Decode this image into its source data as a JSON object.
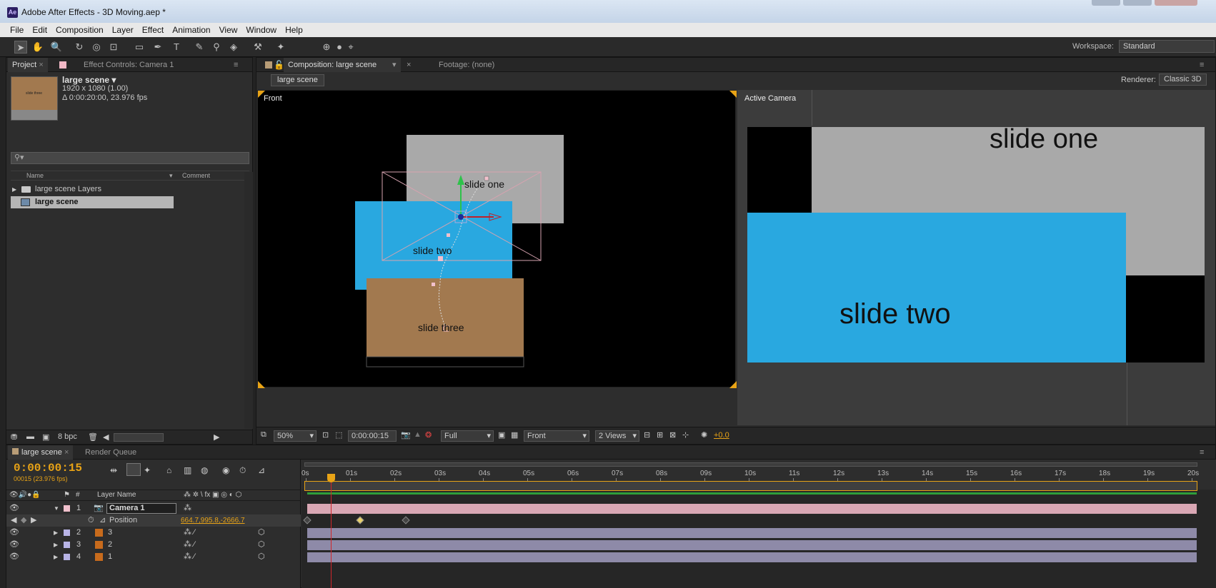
{
  "app": {
    "title": "Adobe After Effects - 3D Moving.aep *",
    "logo": "Ae"
  },
  "menu": [
    "File",
    "Edit",
    "Composition",
    "Layer",
    "Effect",
    "Animation",
    "View",
    "Window",
    "Help"
  ],
  "toolbar": {
    "workspace_label": "Workspace:",
    "workspace_value": "Standard"
  },
  "project_panel": {
    "tab_project": "Project",
    "tab_effect_controls": "Effect Controls: Camera 1",
    "comp_name": "large scene ▾",
    "comp_size": "1920 x 1080 (1.00)",
    "comp_duration": "Δ 0:00:20:00, 23.976 fps",
    "col_name": "Name",
    "col_comment": "Comment",
    "items": [
      {
        "label": "large scene Layers",
        "type": "folder"
      },
      {
        "label": "large scene",
        "type": "composition"
      }
    ],
    "bpc": "8 bpc"
  },
  "composition_panel": {
    "tab_label": "Composition: large scene",
    "footage_tab": "Footage: (none)",
    "breadcrumb": "large scene",
    "renderer_label": "Renderer:",
    "renderer_value": "Classic 3D",
    "front_view_label": "Front",
    "active_camera_label": "Active Camera",
    "front_slides": [
      "slide one",
      "slide two",
      "slide three"
    ],
    "camera_slides": [
      "slide one",
      "slide two"
    ],
    "zoom": "50%",
    "timecode": "0:00:00:15",
    "resolution": "Full",
    "view": "Front",
    "views_layout": "2 Views",
    "exposure": "+0.0"
  },
  "timeline_panel": {
    "tab_label": "large scene",
    "render_queue_tab": "Render Queue",
    "current_time": "0:00:00:15",
    "frame_info": "00015 (23.976 fps)",
    "col_number": "#",
    "col_layer_name": "Layer Name",
    "ruler": [
      "0s",
      "01s",
      "02s",
      "03s",
      "04s",
      "05s",
      "06s",
      "07s",
      "08s",
      "09s",
      "10s",
      "11s",
      "12s",
      "13s",
      "14s",
      "15s",
      "16s",
      "17s",
      "18s",
      "19s",
      "20s"
    ],
    "layers": [
      {
        "num": "1",
        "name": "Camera 1",
        "color": "#f0c0cc"
      },
      {
        "num": "2",
        "name": "3",
        "color": "#b8b4e6"
      },
      {
        "num": "3",
        "name": "2",
        "color": "#b8b4e6"
      },
      {
        "num": "4",
        "name": "1",
        "color": "#b8b4e6"
      }
    ],
    "position_property": "Position",
    "position_value": "664.7,995.8,-2666.7"
  },
  "colors": {
    "accent_orange": "#e8a316",
    "slide_gray": "#a9a9a9",
    "slide_blue": "#29a8e0",
    "slide_brown": "#a2794f",
    "camera_track": "#d9a7b4",
    "layer_track": "#8e8aa8"
  }
}
